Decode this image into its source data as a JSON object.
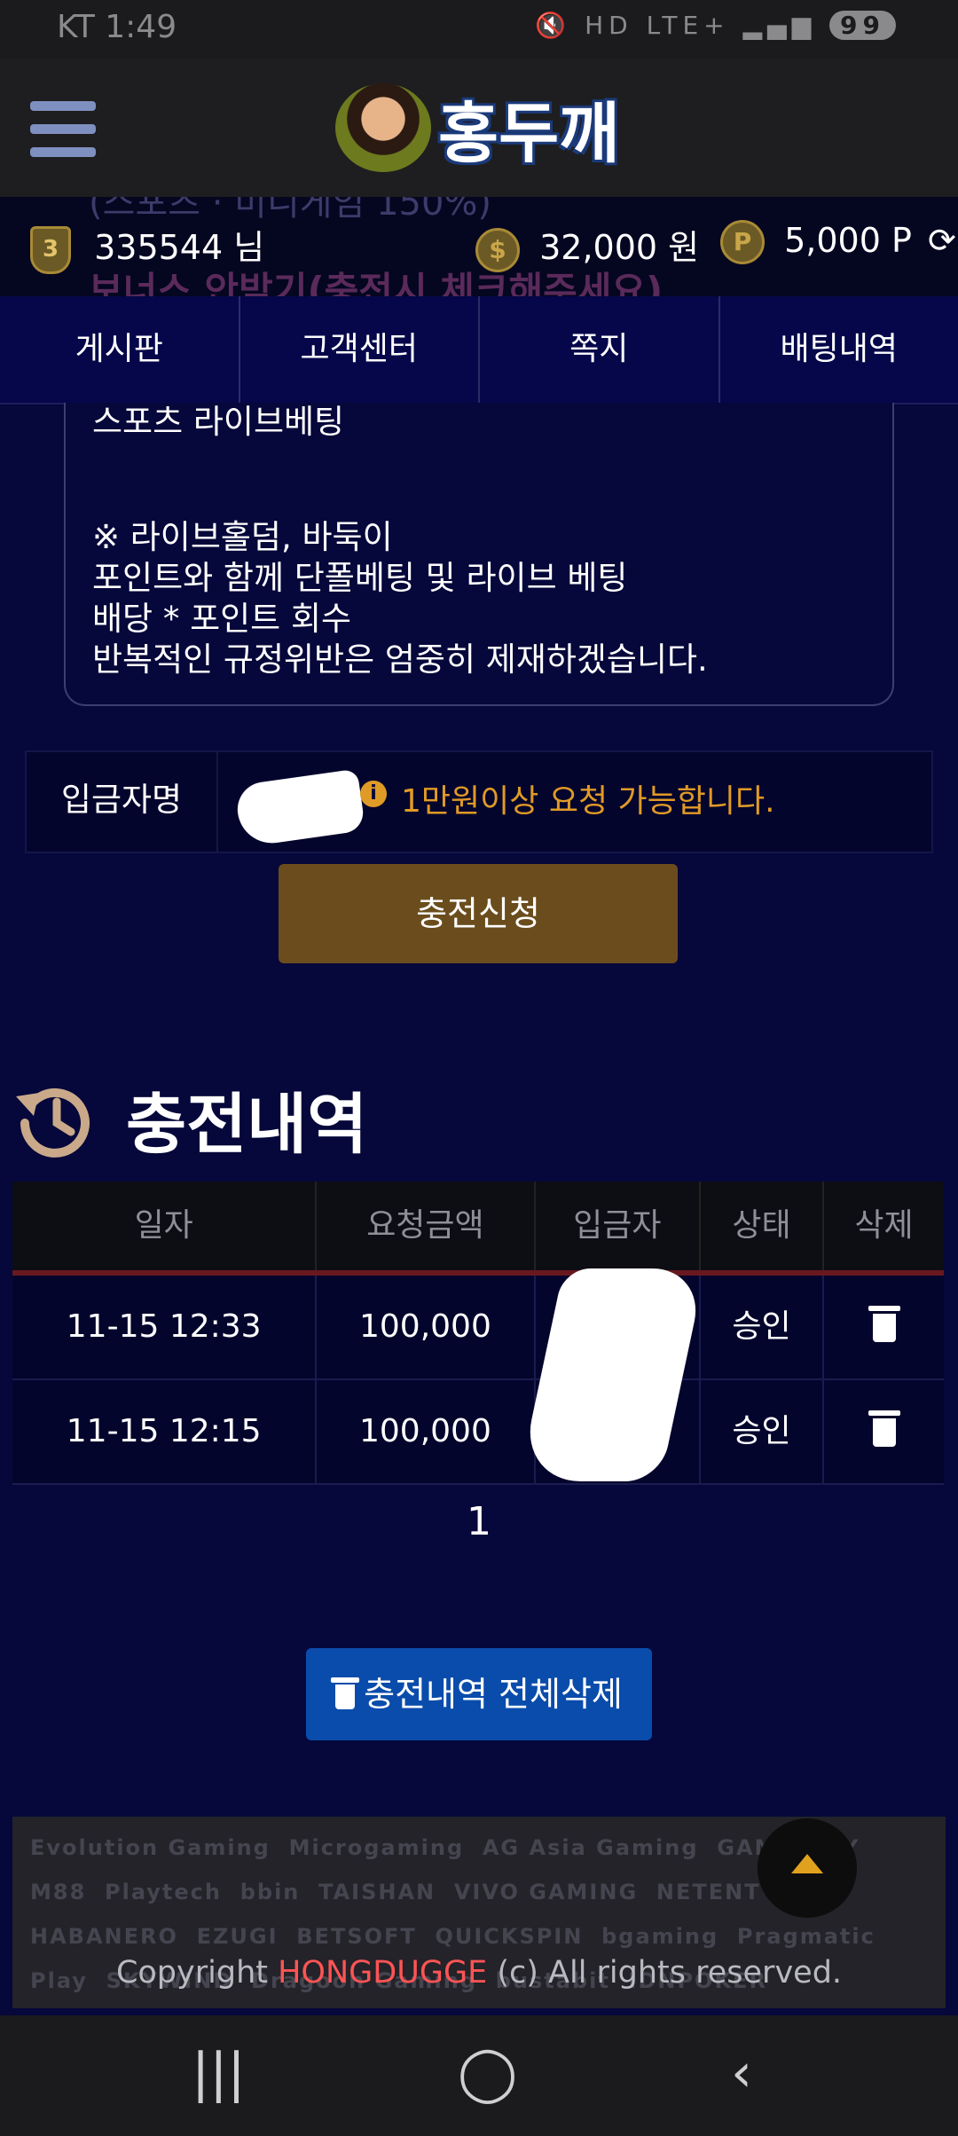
{
  "status_bar": {
    "carrier": "KT",
    "time": "1:49",
    "signal": "LTE+",
    "battery": "99",
    "hd": "HD"
  },
  "header": {
    "logo_text": "홍두깨"
  },
  "ghost_text": {
    "line1": "(스포츠 · 미니게임 150%)",
    "line2": "보너스 안받기(충전시 체크해주세요)"
  },
  "user": {
    "level": "3",
    "username": "335544 님",
    "money": "32,000 원",
    "points": "5,000 P"
  },
  "tabs": [
    "게시판",
    "고객센터",
    "쪽지",
    "배팅내역"
  ],
  "notice": {
    "lines": [
      "스포츠 라이브베팅",
      "",
      "",
      "※ 라이브홀덤, 바둑이",
      "포인트와 함께 단폴베팅 및 라이브 베팅",
      "배당 * 포인트 회수",
      "반복적인 규정위반은 엄중히 제재하겠습니다."
    ]
  },
  "deposit": {
    "label": "입금자명",
    "note": "1만원이상 요청 가능합니다."
  },
  "charge_button": "충전신청",
  "history": {
    "title": "충전내역",
    "columns": [
      "일자",
      "요청금액",
      "입금자",
      "상태",
      "삭제"
    ],
    "rows": [
      {
        "date": "11-15 12:33",
        "amount": "100,000",
        "depositor": "",
        "status": "승인"
      },
      {
        "date": "11-15 12:15",
        "amount": "100,000",
        "depositor": "",
        "status": "승인"
      }
    ],
    "page": "1",
    "delete_all": "충전내역 전체삭제"
  },
  "footer": {
    "partners": [
      "Evolution Gaming",
      "Microgaming",
      "AG Asia Gaming",
      "GAMEPLAY",
      "M88",
      "Playtech",
      "bbin",
      "TAISHAN",
      "VIVO GAMING",
      "NETENT",
      "HABANERO",
      "EZUGI",
      "BETSOFT",
      "QUICKSPIN",
      "bgaming",
      "Pragmatic Play",
      "SKYWIND",
      "Dragoon Gaming",
      "bustabit",
      "IDNPOKER"
    ],
    "copyright_prefix": "Copyright ",
    "brand": "HONGDUGGE",
    "copyright_suffix": " (c) All rights reserved."
  },
  "colors": {
    "background": "#06073a",
    "gold": "#e09a26",
    "charge_button": "#6b4d1d",
    "delete_button": "#0a4cab",
    "brand": "#ff5454"
  }
}
